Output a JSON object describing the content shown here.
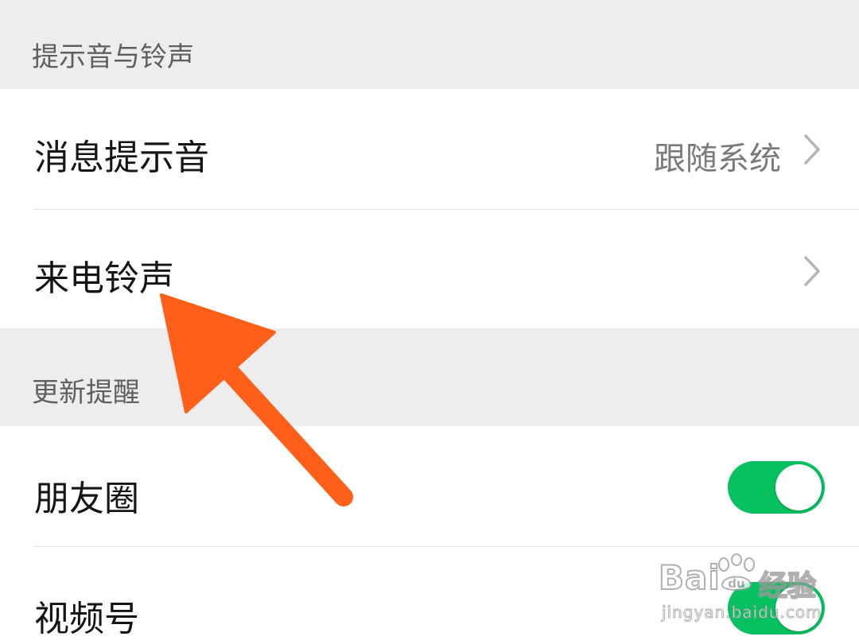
{
  "sections": [
    {
      "header": "提示音与铃声",
      "rows": [
        {
          "label": "消息提示音",
          "value": "跟随系统",
          "control": "chevron"
        },
        {
          "label": "来电铃声",
          "value": "",
          "control": "chevron"
        }
      ]
    },
    {
      "header": "更新提醒",
      "rows": [
        {
          "label": "朋友圈",
          "control": "toggle",
          "on": true
        },
        {
          "label": "视频号",
          "control": "toggle",
          "on": true
        }
      ]
    }
  ],
  "annotation": {
    "arrow_color": "#ff5f19",
    "points_to": "来电铃声"
  },
  "watermark": {
    "brand": "Bai",
    "brand_suffix": "du",
    "product": "经验",
    "url": "jingyan.baidu.com"
  },
  "colors": {
    "toggle_on": "#07c160",
    "section_bg": "#ededed"
  }
}
